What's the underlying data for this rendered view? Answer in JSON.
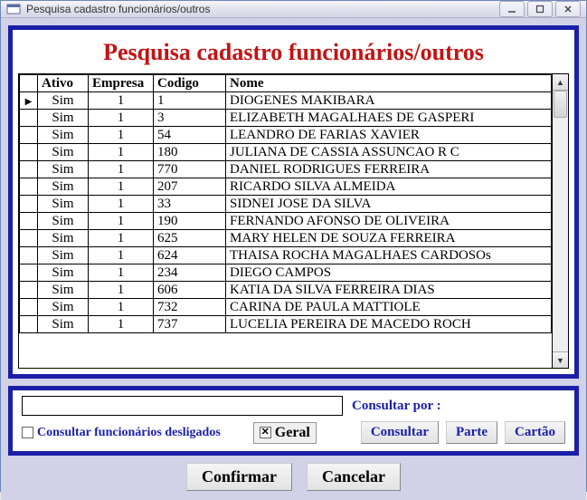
{
  "window": {
    "title": "Pesquisa cadastro funcionários/outros"
  },
  "heading": "Pesquisa cadastro funcionários/outros",
  "table": {
    "columns": {
      "ativo": "Ativo",
      "empresa": "Empresa",
      "codigo": "Codigo",
      "nome": "Nome"
    },
    "rows": [
      {
        "ativo": "Sim",
        "empresa": "1",
        "codigo": "1",
        "nome": "DIOGENES MAKIBARA",
        "current": true
      },
      {
        "ativo": "Sim",
        "empresa": "1",
        "codigo": "3",
        "nome": "ELIZABETH MAGALHAES DE GASPERI"
      },
      {
        "ativo": "Sim",
        "empresa": "1",
        "codigo": "54",
        "nome": "LEANDRO DE FARIAS XAVIER"
      },
      {
        "ativo": "Sim",
        "empresa": "1",
        "codigo": "180",
        "nome": "JULIANA DE CASSIA ASSUNCAO R C"
      },
      {
        "ativo": "Sim",
        "empresa": "1",
        "codigo": "770",
        "nome": "DANIEL RODRIGUES FERREIRA"
      },
      {
        "ativo": "Sim",
        "empresa": "1",
        "codigo": "207",
        "nome": "RICARDO SILVA ALMEIDA"
      },
      {
        "ativo": "Sim",
        "empresa": "1",
        "codigo": "33",
        "nome": "SIDNEI JOSE DA SILVA"
      },
      {
        "ativo": "Sim",
        "empresa": "1",
        "codigo": "190",
        "nome": "FERNANDO AFONSO DE OLIVEIRA"
      },
      {
        "ativo": "Sim",
        "empresa": "1",
        "codigo": "625",
        "nome": "MARY HELEN DE SOUZA FERREIRA"
      },
      {
        "ativo": "Sim",
        "empresa": "1",
        "codigo": "624",
        "nome": "THAISA ROCHA MAGALHAES CARDOSOs"
      },
      {
        "ativo": "Sim",
        "empresa": "1",
        "codigo": "234",
        "nome": "DIEGO CAMPOS"
      },
      {
        "ativo": "Sim",
        "empresa": "1",
        "codigo": "606",
        "nome": "KATIA DA SILVA FERREIRA DIAS"
      },
      {
        "ativo": "Sim",
        "empresa": "1",
        "codigo": "732",
        "nome": "CARINA DE PAULA MATTIOLE"
      },
      {
        "ativo": "Sim",
        "empresa": "1",
        "codigo": "737",
        "nome": "LUCELIA PEREIRA DE MACEDO ROCH"
      }
    ]
  },
  "search": {
    "value": "",
    "consultar_por_label": "Consultar por :",
    "chk_desligados_label": "Consultar funcionários desligados",
    "chk_desligados_checked": false,
    "chk_geral_label": "Geral",
    "chk_geral_checked": true,
    "btn_consultar": "Consultar",
    "btn_parte": "Parte",
    "btn_cartao": "Cartão"
  },
  "actions": {
    "confirmar": "Confirmar",
    "cancelar": "Cancelar"
  }
}
